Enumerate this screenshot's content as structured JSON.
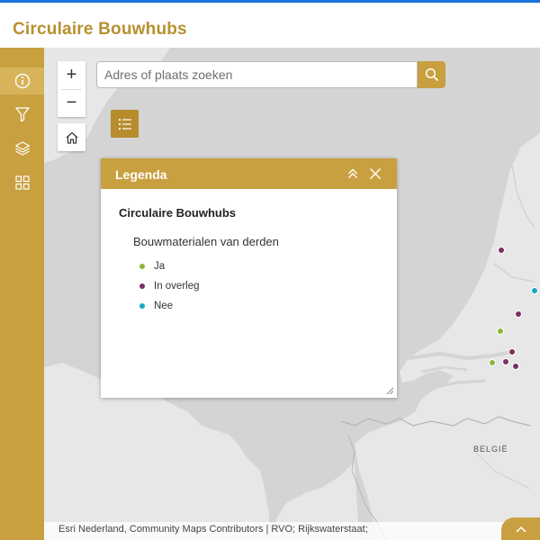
{
  "app": {
    "title": "Circulaire Bouwhubs"
  },
  "sidebar": {
    "items": [
      {
        "name": "info",
        "icon": "info-icon",
        "active": true
      },
      {
        "name": "filter",
        "icon": "filter-icon",
        "active": false
      },
      {
        "name": "layers",
        "icon": "layers-icon",
        "active": false
      },
      {
        "name": "basemap",
        "icon": "grid-icon",
        "active": false
      }
    ]
  },
  "map": {
    "zoom_in_label": "+",
    "zoom_out_label": "−",
    "home_icon": "home-icon",
    "country_label": "BELGIË",
    "attribution": "Esri Nederland, Community Maps Contributors | RVO; Rijkswaterstaat;"
  },
  "search": {
    "placeholder": "Adres of plaats zoeken",
    "value": ""
  },
  "legend": {
    "title": "Legenda",
    "layer_title": "Circulaire Bouwhubs",
    "field_title": "Bouwmaterialen van derden",
    "items": [
      {
        "label": "Ja",
        "color": "#8fb63c"
      },
      {
        "label": "In overleg",
        "color": "#7a2e62"
      },
      {
        "label": "Nee",
        "color": "#1aa3c8"
      }
    ]
  },
  "colors": {
    "accent": "#c8a040",
    "title": "#b7902f",
    "land": "#e6e6e6",
    "water": "#d4d4d4"
  }
}
